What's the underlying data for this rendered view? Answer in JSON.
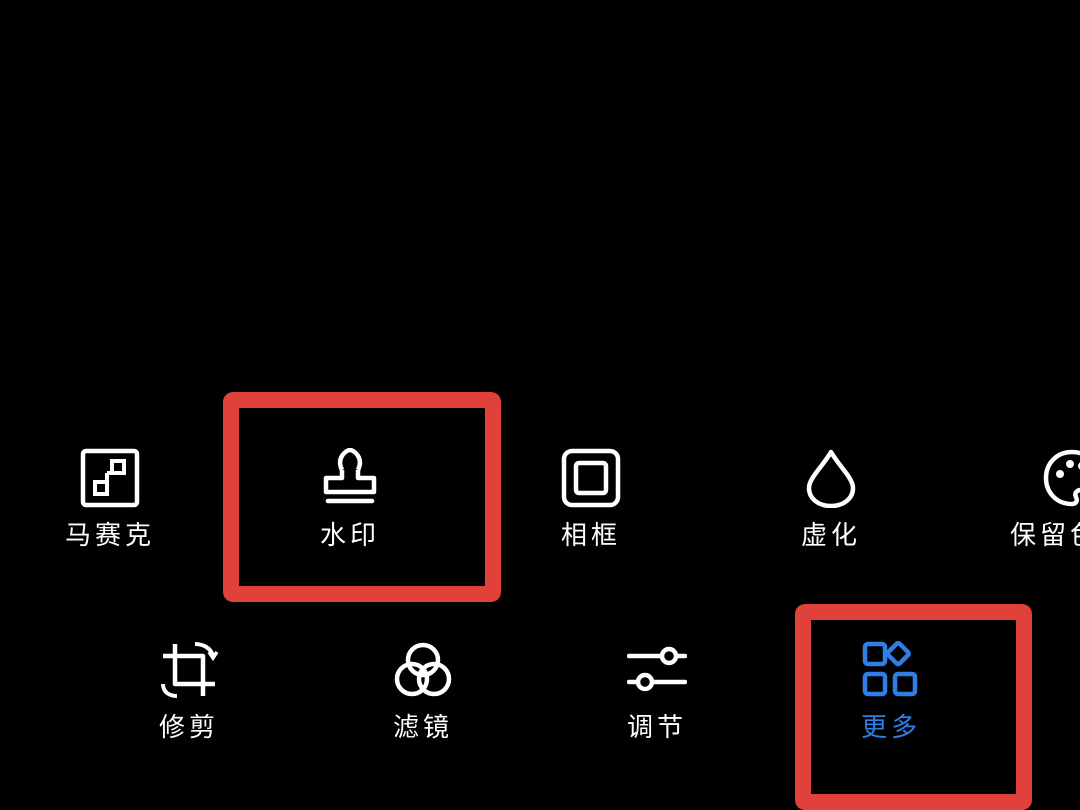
{
  "toolbar": {
    "row1": [
      {
        "id": "mosaic",
        "label": "马赛克",
        "icon": "mosaic-icon"
      },
      {
        "id": "watermark",
        "label": "水印",
        "icon": "stamp-icon"
      },
      {
        "id": "frame",
        "label": "相框",
        "icon": "frame-icon"
      },
      {
        "id": "blur",
        "label": "虚化",
        "icon": "droplet-icon"
      },
      {
        "id": "color-retention",
        "label": "保留色",
        "icon": "palette-icon"
      }
    ],
    "row2": [
      {
        "id": "crop",
        "label": "修剪",
        "icon": "crop-icon"
      },
      {
        "id": "filter",
        "label": "滤镜",
        "icon": "filter-icon"
      },
      {
        "id": "adjust",
        "label": "调节",
        "icon": "sliders-icon"
      },
      {
        "id": "more",
        "label": "更多",
        "icon": "grid-more-icon"
      }
    ]
  },
  "colors": {
    "background": "#000000",
    "icon": "#ffffff",
    "active": "#2f7ee6",
    "highlight": "#e0413a"
  }
}
